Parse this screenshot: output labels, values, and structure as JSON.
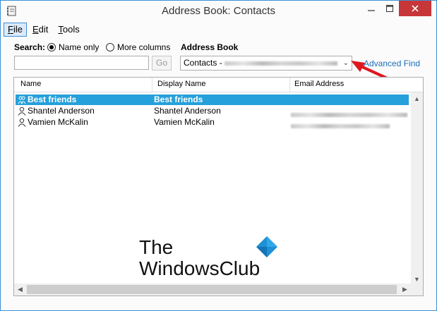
{
  "window": {
    "title": "Address Book: Contacts"
  },
  "menu": [
    {
      "label": "File",
      "accel": "F",
      "rest": "ile"
    },
    {
      "label": "Edit",
      "accel": "E",
      "rest": "dit"
    },
    {
      "label": "Tools",
      "accel": "T",
      "rest": "ools"
    }
  ],
  "search": {
    "label": "Search:",
    "name_only_label": "Name only",
    "more_columns_label": "More columns",
    "name_only_checked": true,
    "value": "",
    "go_label": "Go"
  },
  "address_book": {
    "label": "Address Book",
    "selected": "Contacts - ",
    "advanced_find_label": "Advanced Find"
  },
  "table": {
    "columns": [
      "Name",
      "Display Name",
      "Email Address"
    ],
    "rows": [
      {
        "name": "Best friends",
        "display_name": "Best friends",
        "email": "",
        "type": "group-icon",
        "selected": true
      },
      {
        "name": "Shantel Anderson",
        "display_name": "Shantel Anderson",
        "email": "",
        "type": "person-icon",
        "selected": false
      },
      {
        "name": "Vamien McKalin",
        "display_name": "Vamien McKalin",
        "email": "",
        "type": "person-icon",
        "selected": false
      }
    ]
  },
  "watermark": {
    "line1": "The",
    "line2": "WindowsClub"
  },
  "colors": {
    "selection": "#26a0da",
    "close_button": "#c7373a",
    "link": "#1a6fb7",
    "arrow": "#e0161d"
  }
}
